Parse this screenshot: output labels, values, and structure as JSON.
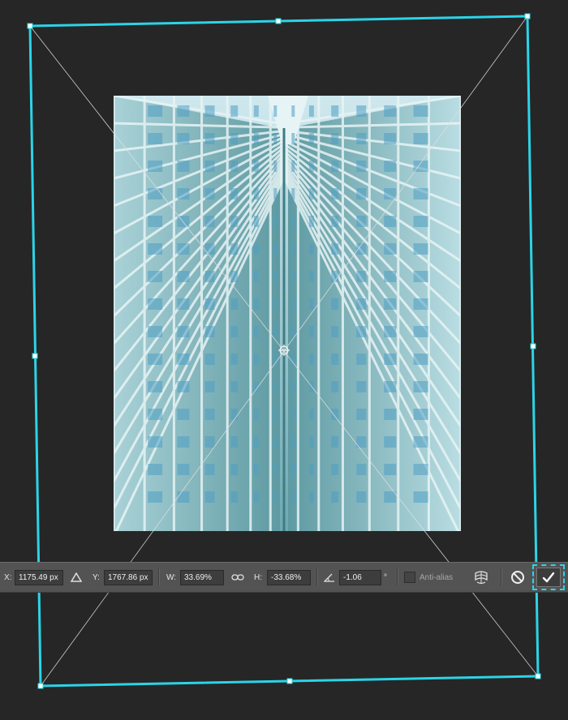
{
  "options_bar": {
    "x_label": "X:",
    "x_value": "1175.49 px",
    "ref_point_icon": "triangle-delta-icon",
    "y_label": "Y:",
    "y_value": "1767.86 px",
    "w_label": "W:",
    "w_value": "33.69%",
    "link_icon": "link-chain-icon",
    "h_label": "H:",
    "h_value": "-33.68%",
    "angle_icon": "angle-icon",
    "angle_value": "-1.06",
    "angle_unit": "°",
    "antialias_label": "Anti-alias",
    "antialias_checked": false,
    "warp_icon": "warp-mode-icon",
    "cancel_icon": "cancel-transform-icon",
    "commit_icon": "commit-checkmark-icon"
  },
  "colors": {
    "canvas_background": "#262626",
    "transform_outline": "#2bd4e8",
    "options_bar": "#535353"
  }
}
